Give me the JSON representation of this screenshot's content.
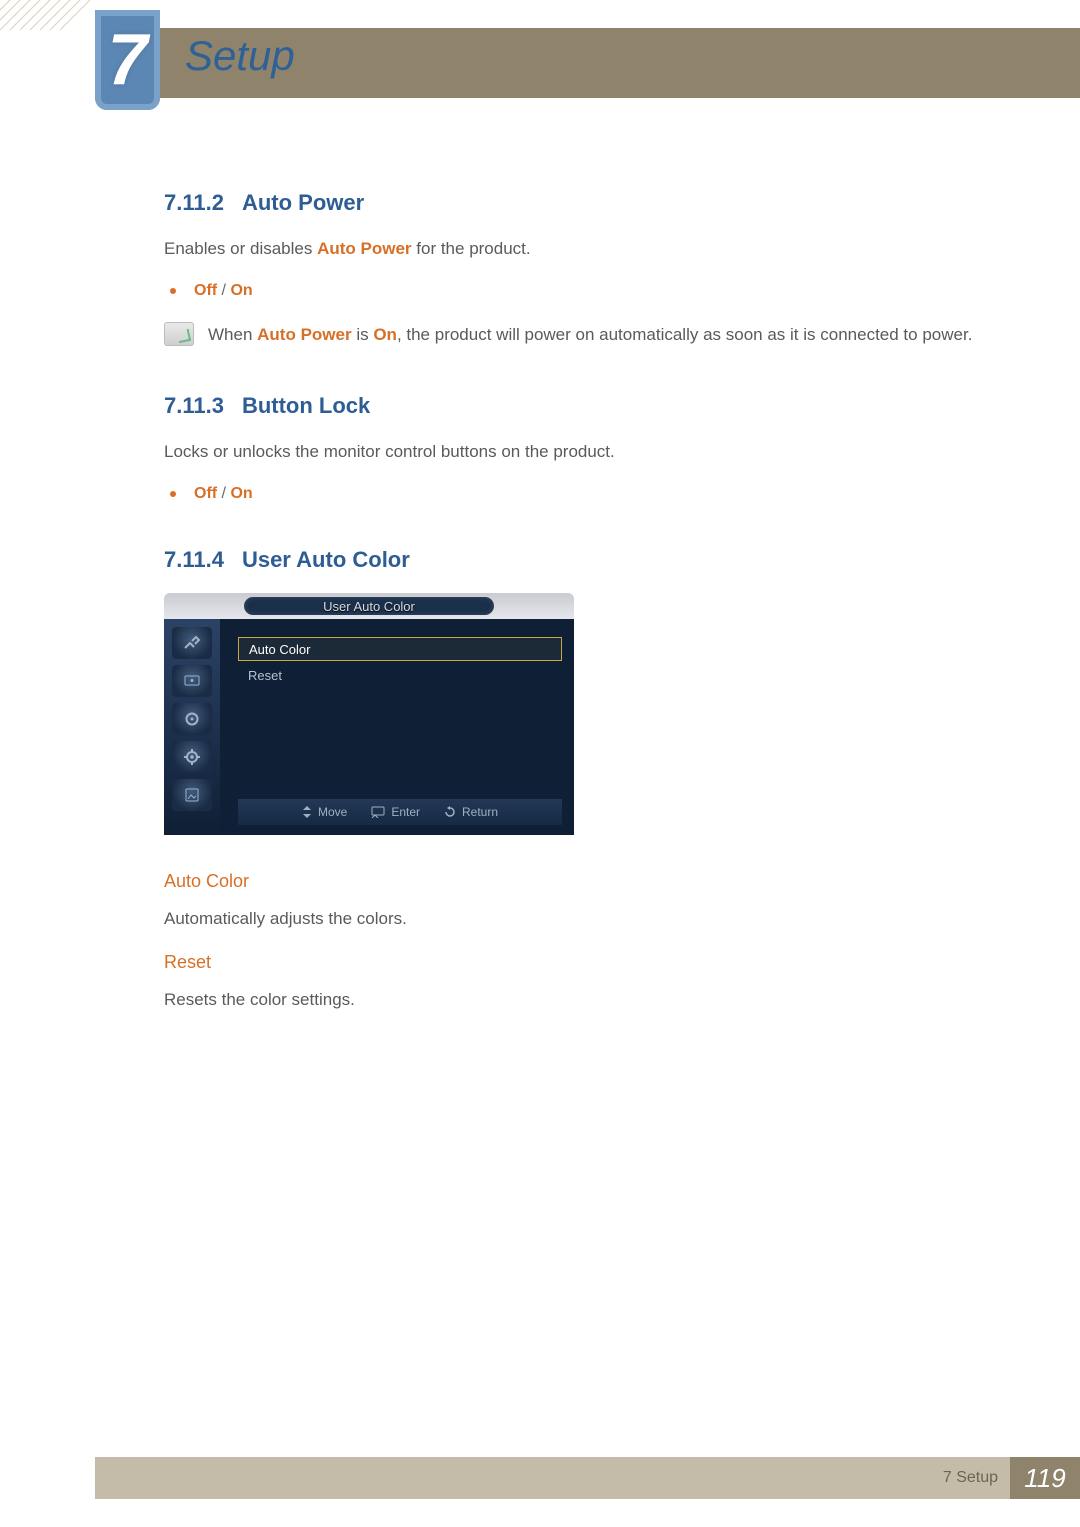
{
  "chapter": {
    "number": "7",
    "title": "Setup"
  },
  "sections": {
    "s1": {
      "num": "7.11.2",
      "title": "Auto Power",
      "desc_pre": "Enables or disables ",
      "desc_hl": "Auto Power",
      "desc_post": " for the product.",
      "opt_off": "Off",
      "opt_slash": " / ",
      "opt_on": "On",
      "note_pre": "When ",
      "note_hl1": "Auto Power",
      "note_mid": " is ",
      "note_hl2": "On",
      "note_post": ", the product will power on automatically as soon as it is connected to power."
    },
    "s2": {
      "num": "7.11.3",
      "title": "Button Lock",
      "desc": "Locks or unlocks the monitor control buttons on the product.",
      "opt_off": "Off",
      "opt_slash": " / ",
      "opt_on": "On"
    },
    "s3": {
      "num": "7.11.4",
      "title": "User Auto Color"
    }
  },
  "osd": {
    "title": "User Auto Color",
    "items": [
      "Auto Color",
      "Reset"
    ],
    "foot": {
      "move": "Move",
      "enter": "Enter",
      "return": "Return"
    }
  },
  "sub": {
    "autoColor": {
      "title": "Auto Color",
      "desc": "Automatically adjusts the colors."
    },
    "reset": {
      "title": "Reset",
      "desc": "Resets the color settings."
    }
  },
  "footer": {
    "label": "7 Setup",
    "page": "119"
  }
}
